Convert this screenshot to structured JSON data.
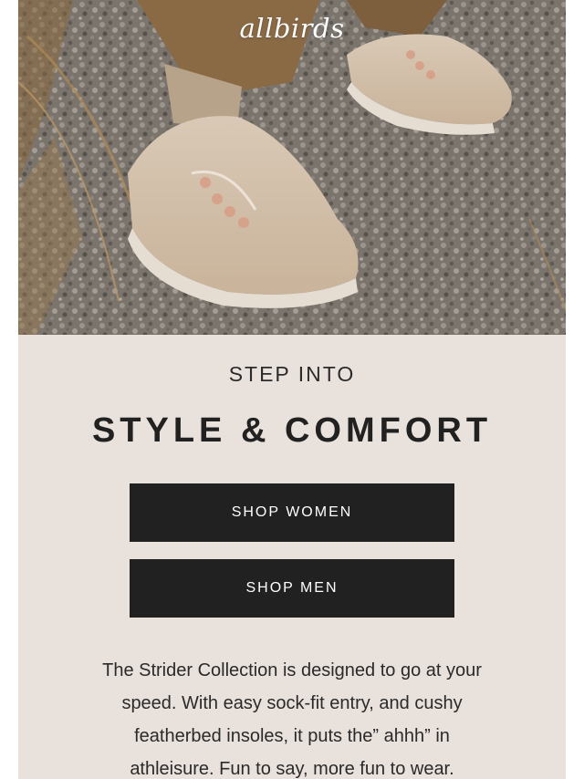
{
  "brand": {
    "logo_text": "allbirds"
  },
  "hero": {
    "image_name": "strider-sneakers-on-gravel-photo"
  },
  "content": {
    "eyebrow": "STEP INTO",
    "headline": "STYLE & COMFORT",
    "buttons": {
      "women_label": "SHOP WOMEN",
      "men_label": "SHOP MEN"
    },
    "body": "The Strider Collection is designed to go at your speed. With easy sock-fit entry, and cushy featherbed insoles, it puts the” ahhh” in athleisure. Fun to say, more fun to wear."
  },
  "colors": {
    "panel_background": "#e9e1dc",
    "button_background": "#212121",
    "button_text": "#ffffff",
    "text": "#212121"
  }
}
